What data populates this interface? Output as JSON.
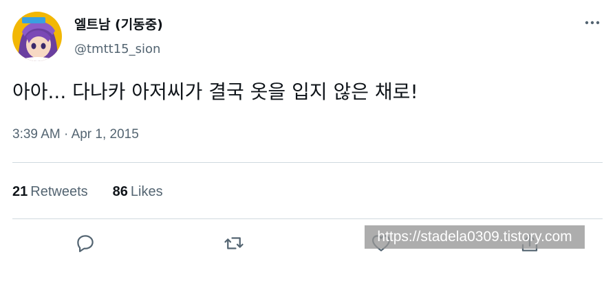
{
  "tweet": {
    "author": {
      "display_name": "엘트남 (기동중)",
      "handle": "@tmtt15_sion",
      "avatar_icon": "anime-character-avatar"
    },
    "text": "아아... 다나카 아저씨가 결국 옷을 입지 않은 채로!",
    "timestamp": {
      "time": "3:39 AM",
      "separator": " · ",
      "date": "Apr 1, 2015"
    },
    "stats": {
      "retweets_count": "21",
      "retweets_label": "Retweets",
      "likes_count": "86",
      "likes_label": "Likes"
    },
    "actions": [
      {
        "name": "reply",
        "icon": "reply-icon"
      },
      {
        "name": "retweet",
        "icon": "retweet-icon"
      },
      {
        "name": "like",
        "icon": "heart-icon"
      },
      {
        "name": "share",
        "icon": "share-icon"
      }
    ]
  },
  "watermark": {
    "text": "https://stadela0309.tistory.com"
  },
  "colors": {
    "text_primary": "#0f1419",
    "text_secondary": "#536471",
    "divider": "#cfd9de",
    "background": "#ffffff"
  }
}
